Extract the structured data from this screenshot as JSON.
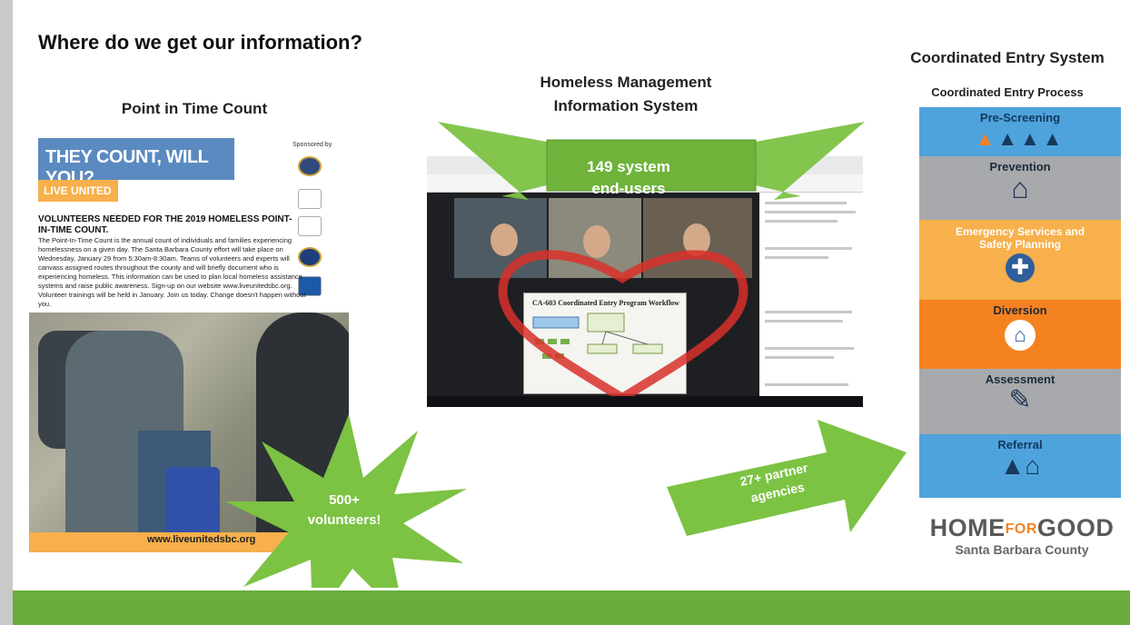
{
  "slide": {
    "title": "Where do we get our information?",
    "sections": {
      "pit": "Point in Time Count",
      "hmis_line1": "Homeless Management",
      "hmis_line2": "Information System",
      "ces": "Coordinated Entry System",
      "cep": "Coordinated Entry Process"
    },
    "poster": {
      "banner": "THEY COUNT, WILL YOU?",
      "live": "LIVE UNITED",
      "sponsored": "Sponsored by",
      "heading": "VOLUNTEERS NEEDED FOR THE 2019 HOMELESS POINT-IN-TIME COUNT.",
      "body": "The Point-In-Time Count is the annual count of individuals and families experiencing homelessness on a given day. The Santa Barbara County effort will take place on Wednesday, January 29 from 5:30am-8:30am. Teams of volunteers and experts will canvass assigned routes throughout the county and will briefly document who is experiencing homeless. This information can be used to plan local homeless assistance systems and raise public awareness. Sign-up on our website www.liveunitedsbc.org. Volunteer trainings will be held in January. Join us today. Change doesn't happen without you.",
      "url": "www.liveunitedsbc.org"
    },
    "hmis": {
      "ribbon_line1": "149 system",
      "ribbon_line2": "end-users",
      "doc_title": "CA-603 Coordinated Entry Program Workflow"
    },
    "callouts": {
      "volunteers_line1": "500+",
      "volunteers_line2": "volunteers!",
      "partners_line1": "27+ partner",
      "partners_line2": "agencies"
    },
    "ce_steps": [
      {
        "label": "Pre-Screening",
        "color": "#4fa3dc",
        "icon": "people-icon"
      },
      {
        "label": "Prevention",
        "color": "#a7a9ac",
        "icon": "house-icon"
      },
      {
        "label": "Emergency Services and Safety Planning",
        "color": "#f7b04b",
        "icon": "medical-cross-icon"
      },
      {
        "label": "Diversion",
        "color": "#f58220",
        "icon": "family-house-icon"
      },
      {
        "label": "Assessment",
        "color": "#a7a9ac",
        "icon": "checklist-icon"
      },
      {
        "label": "Referral",
        "color": "#4fa3dc",
        "icon": "family-referral-icon"
      }
    ],
    "logo": {
      "main_left": "HOME",
      "main_mid": "FOR",
      "main_right": "GOOD",
      "sub": "Santa Barbara County"
    },
    "colors": {
      "green": "#6aac3e",
      "accent_orange": "#f58220"
    }
  }
}
